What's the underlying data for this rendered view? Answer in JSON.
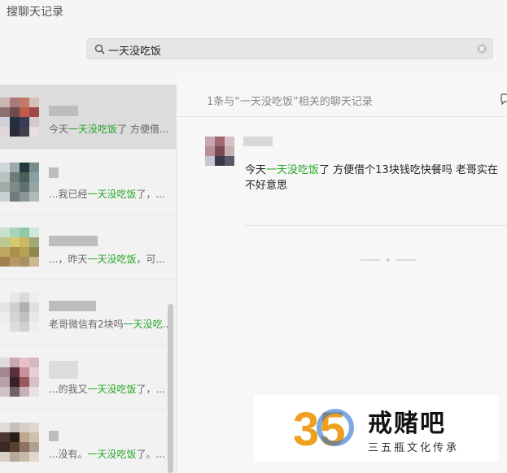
{
  "app": {
    "title": "搜聊天记录"
  },
  "search": {
    "query": "一天没吃饭"
  },
  "conversations": [
    {
      "pre": "今天",
      "hl": "一天没吃饭",
      "post": "了 方便借..."
    },
    {
      "pre": "...我已经",
      "hl": "一天没吃饭",
      "post": "了，..."
    },
    {
      "pre": "...，昨天",
      "hl": "一天没吃饭",
      "post": "，可..."
    },
    {
      "pre": "老哥微信有2块吗",
      "hl": "一天没吃",
      "post": "..."
    },
    {
      "pre": "...的我又",
      "hl": "一天没吃饭",
      "post": "了，..."
    },
    {
      "pre": "...没有。",
      "hl": "一天没吃饭",
      "post": "了。..."
    }
  ],
  "results": {
    "count_label": "1条与“一天没吃饭”相关的聊天记录",
    "message": {
      "pre": "今天",
      "hl": "一天没吃饭",
      "post": "了  方便借个13块钱吃快餐吗 老哥实在不好意思"
    }
  },
  "watermark": {
    "number": "35",
    "title": "戒赌吧",
    "subtitle": "三五瓶文化传承"
  },
  "colors": {
    "highlight": "#2aa52a",
    "selected": "#dcdcdc"
  }
}
